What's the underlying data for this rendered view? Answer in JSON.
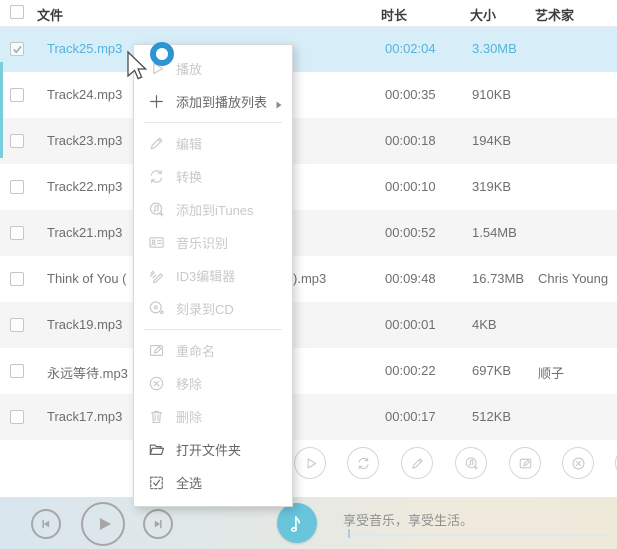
{
  "colors": {
    "accent": "#54b4dc",
    "selected_row_bg": "#d7eef8",
    "stripe_row_bg": "#f5f5f5",
    "scrollbar": "#79cedd",
    "note_button": "#68c5dc"
  },
  "table": {
    "columns": [
      {
        "key": "file",
        "label": "文件"
      },
      {
        "key": "duration",
        "label": "时长"
      },
      {
        "key": "size",
        "label": "大小"
      },
      {
        "key": "artist",
        "label": "艺术家"
      }
    ],
    "rows": [
      {
        "name": "Track25.mp3",
        "duration": "00:02:04",
        "size": "3.30MB",
        "artist": "",
        "checked": true,
        "selected": true
      },
      {
        "name": "Track24.mp3",
        "duration": "00:00:35",
        "size": "910KB",
        "artist": "",
        "checked": false
      },
      {
        "name": "Track23.mp3",
        "duration": "00:00:18",
        "size": "194KB",
        "artist": "",
        "checked": false
      },
      {
        "name": "Track22.mp3",
        "duration": "00:00:10",
        "size": "319KB",
        "artist": "",
        "checked": false
      },
      {
        "name": "Track21.mp3",
        "duration": "00:00:52",
        "size": "1.54MB",
        "artist": "",
        "checked": false
      },
      {
        "name": "Think of You (",
        "name_suffix": ").mp3",
        "duration": "00:09:48",
        "size": "16.73MB",
        "artist": "Chris Young",
        "checked": false
      },
      {
        "name": "Track19.mp3",
        "duration": "00:00:01",
        "size": "4KB",
        "artist": "",
        "checked": false
      },
      {
        "name": "永远等待.mp3",
        "duration": "00:00:22",
        "size": "697KB",
        "artist": "顺子",
        "checked": false
      },
      {
        "name": "Track17.mp3",
        "duration": "00:00:17",
        "size": "512KB",
        "artist": "",
        "checked": false
      }
    ]
  },
  "context_menu": {
    "items": [
      {
        "id": "play",
        "label": "播放",
        "icon": "play-icon",
        "enabled": false
      },
      {
        "id": "add-to-playlist",
        "label": "添加到播放列表",
        "icon": "add-playlist-icon",
        "enabled": true,
        "submenu": true
      },
      {
        "divider": true
      },
      {
        "id": "edit",
        "label": "编辑",
        "icon": "edit-icon",
        "enabled": false
      },
      {
        "id": "convert",
        "label": "转换",
        "icon": "convert-icon",
        "enabled": false
      },
      {
        "id": "add-to-itunes",
        "label": "添加到iTunes",
        "icon": "itunes-icon",
        "enabled": false
      },
      {
        "id": "music-recognition",
        "label": "音乐识别",
        "icon": "music-id-icon",
        "enabled": false
      },
      {
        "id": "id3-editor",
        "label": "ID3编辑器",
        "icon": "id3-editor-icon",
        "enabled": false
      },
      {
        "id": "burn-to-cd",
        "label": "刻录到CD",
        "icon": "burn-cd-icon",
        "enabled": false
      },
      {
        "divider": true
      },
      {
        "id": "rename",
        "label": "重命名",
        "icon": "rename-icon",
        "enabled": false
      },
      {
        "id": "remove",
        "label": "移除",
        "icon": "remove-icon",
        "enabled": false
      },
      {
        "id": "delete",
        "label": "删除",
        "icon": "delete-icon",
        "enabled": false
      },
      {
        "id": "open-folder",
        "label": "打开文件夹",
        "icon": "open-folder-icon",
        "enabled": true
      },
      {
        "id": "select-all",
        "label": "全选",
        "icon": "select-all-icon",
        "enabled": true
      }
    ]
  },
  "toolbar": {
    "buttons": [
      {
        "id": "play",
        "icon": "play-icon"
      },
      {
        "id": "convert",
        "icon": "convert-icon"
      },
      {
        "id": "edit",
        "icon": "edit-icon"
      },
      {
        "id": "add-to-itunes",
        "icon": "itunes-icon"
      },
      {
        "id": "rename",
        "icon": "rename-icon"
      },
      {
        "id": "remove",
        "icon": "remove-icon"
      },
      {
        "id": "overflow",
        "icon": ""
      }
    ]
  },
  "player": {
    "slogan": "享受音乐，享受生活。",
    "buttons": [
      {
        "id": "previous",
        "icon": "prev-icon"
      },
      {
        "id": "play",
        "icon": "play-filled-icon"
      },
      {
        "id": "next",
        "icon": "next-icon"
      }
    ],
    "note_button_icon": "note-icon"
  }
}
